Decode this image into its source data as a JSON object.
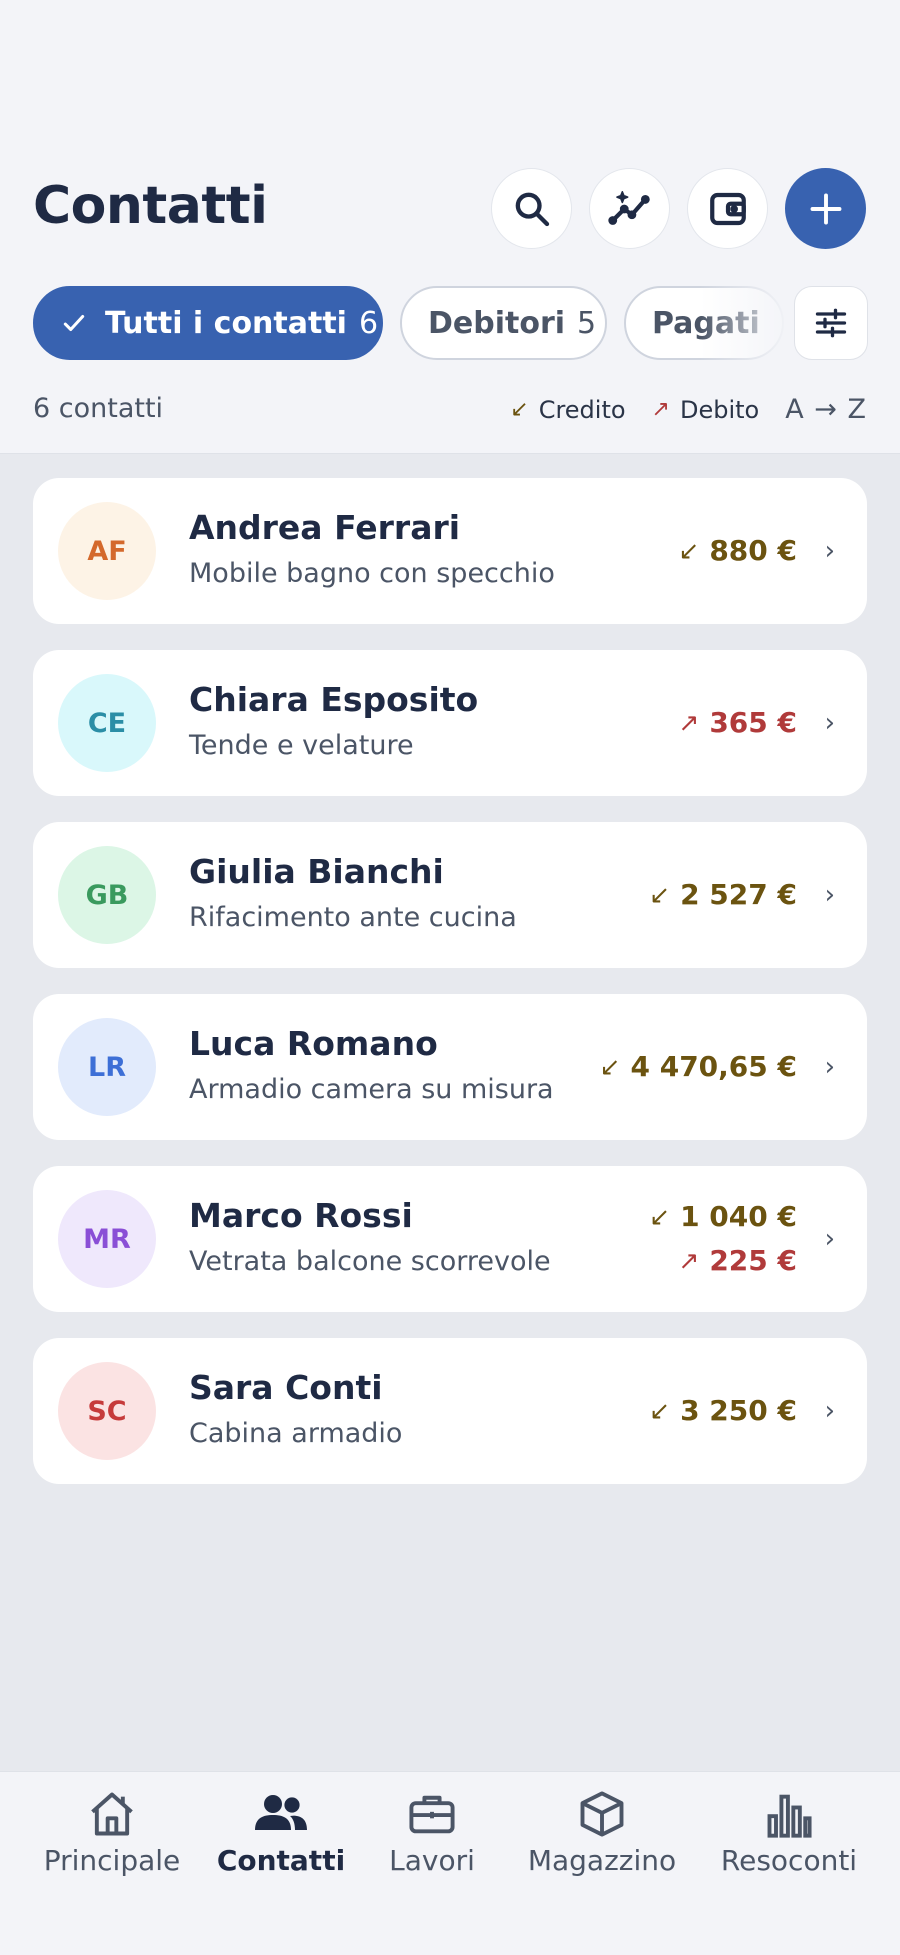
{
  "header": {
    "title": "Contatti",
    "search_icon": "search-icon",
    "insights_icon": "sparkle-chart-icon",
    "wallet_icon": "wallet-icon",
    "add_icon": "plus-icon"
  },
  "filters": {
    "chips": [
      {
        "label": "Tutti i contatti",
        "count": "6",
        "active": true
      },
      {
        "label": "Debitori",
        "count": "5",
        "active": false
      },
      {
        "label": "Pagati",
        "count": "",
        "active": false
      }
    ],
    "filter_icon": "sliders-icon"
  },
  "summary": {
    "count_label": "6 contatti",
    "credit_label": "Credito",
    "debit_label": "Debito",
    "sort_label": "A → Z",
    "credit_arrow": "↙",
    "debit_arrow": "↗"
  },
  "colors": {
    "accent": "#3862b0",
    "credit": "#6b5310",
    "debit": "#b03a3a"
  },
  "contacts": [
    {
      "initials": "AF",
      "name": "Andrea Ferrari",
      "desc": "Mobile bagno con specchio",
      "avatar_bg": "#fdf3e6",
      "avatar_fg": "#d4692c",
      "credit": "880 €",
      "debit": ""
    },
    {
      "initials": "CE",
      "name": "Chiara Esposito",
      "desc": "Tende e velature",
      "avatar_bg": "#d9f8fb",
      "avatar_fg": "#2b8ea6",
      "credit": "",
      "debit": "365 €"
    },
    {
      "initials": "GB",
      "name": "Giulia Bianchi",
      "desc": "Rifacimento ante cucina",
      "avatar_bg": "#dcf6e6",
      "avatar_fg": "#3a9a5e",
      "credit": "2 527 €",
      "debit": ""
    },
    {
      "initials": "LR",
      "name": "Luca Romano",
      "desc": "Armadio camera su misura",
      "avatar_bg": "#e2ebfc",
      "avatar_fg": "#3d6fd6",
      "credit": "4 470,65 €",
      "debit": ""
    },
    {
      "initials": "MR",
      "name": "Marco Rossi",
      "desc": "Vetrata balcone scorrevole",
      "avatar_bg": "#efe8fc",
      "avatar_fg": "#8a4fd6",
      "credit": "1 040 €",
      "debit": "225 €"
    },
    {
      "initials": "SC",
      "name": "Sara Conti",
      "desc": "Cabina armadio",
      "avatar_bg": "#fbe3e3",
      "avatar_fg": "#c63b3b",
      "credit": "3 250 €",
      "debit": ""
    }
  ],
  "tabs": [
    {
      "label": "Principale",
      "icon": "home-icon",
      "active": false
    },
    {
      "label": "Contatti",
      "icon": "people-icon",
      "active": true
    },
    {
      "label": "Lavori",
      "icon": "briefcase-icon",
      "active": false
    },
    {
      "label": "Magazzino",
      "icon": "box-icon",
      "active": false
    },
    {
      "label": "Resoconti",
      "icon": "bar-chart-icon",
      "active": false
    }
  ]
}
